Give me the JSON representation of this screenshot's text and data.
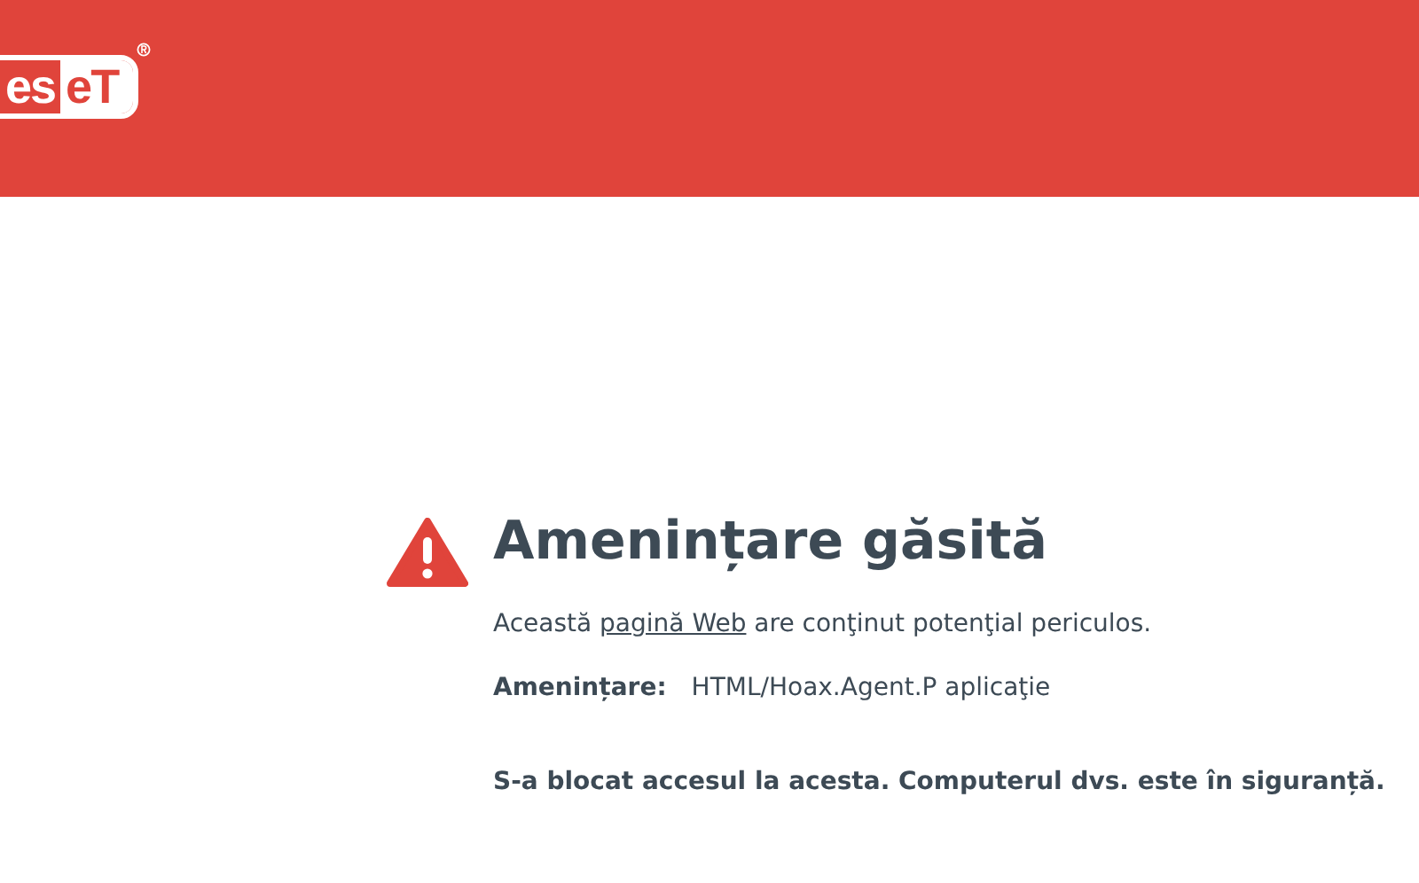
{
  "header": {
    "logo": [
      "es",
      "eT"
    ]
  },
  "alert": {
    "title": "Amenințare găsită",
    "message": {
      "before": "Această ",
      "link": "pagină Web",
      "after": " are conţinut potenţial periculos."
    },
    "threat": {
      "label": "Amenințare:",
      "value": "HTML/Hoax.Agent.P aplicaţie"
    },
    "status": "S-a blocat accesul la acesta. Computerul dvs. este în siguranță."
  }
}
